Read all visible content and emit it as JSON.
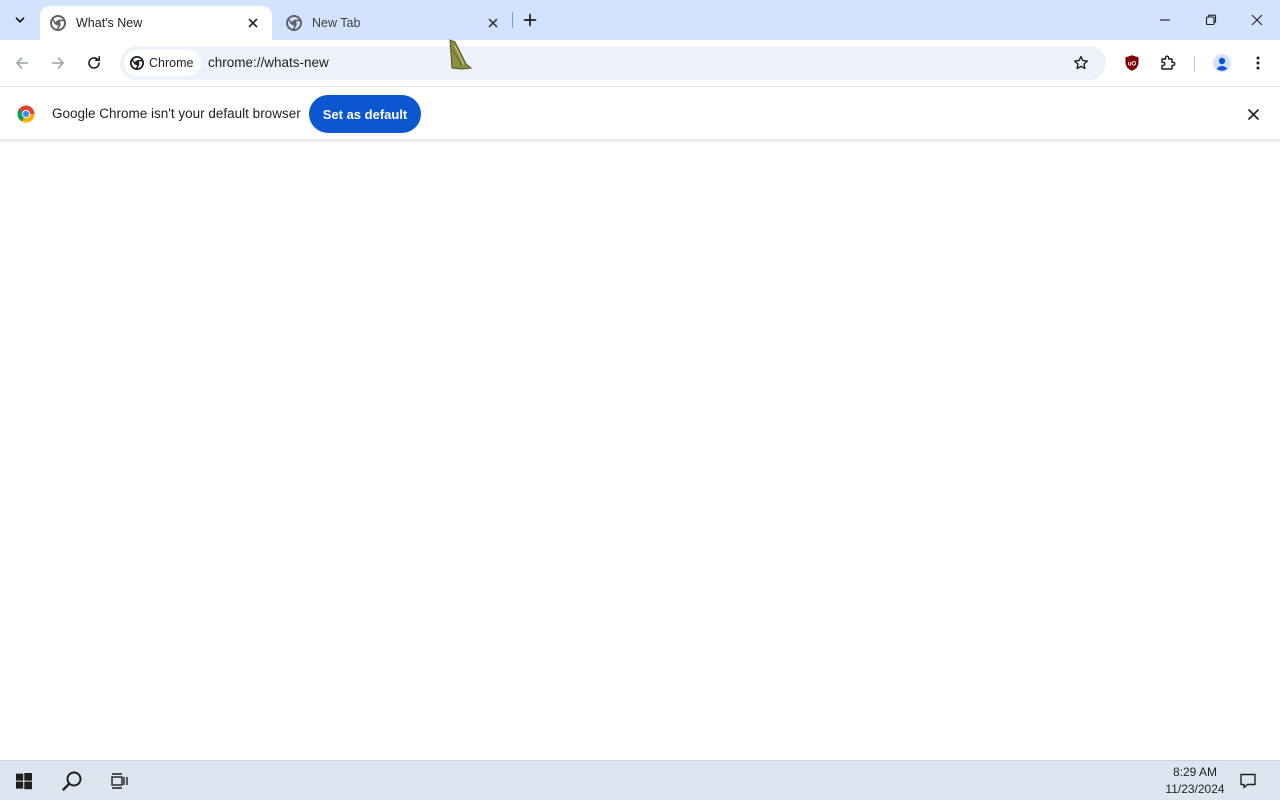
{
  "browser": {
    "tabs": [
      {
        "title": "What's New",
        "active": true
      },
      {
        "title": "New Tab",
        "active": false
      }
    ],
    "omnibox": {
      "chip_label": "Chrome",
      "url": "chrome://whats-new"
    },
    "infobar": {
      "message": "Google Chrome isn't your default browser",
      "button_label": "Set as default"
    }
  },
  "taskbar": {
    "time": "8:29 AM",
    "date": "11/23/2024"
  },
  "colors": {
    "tabstrip": "#d3e3fd",
    "omnibox": "#edf2fa",
    "primary_button": "#0b57d0",
    "taskbar": "#dde6f0"
  }
}
